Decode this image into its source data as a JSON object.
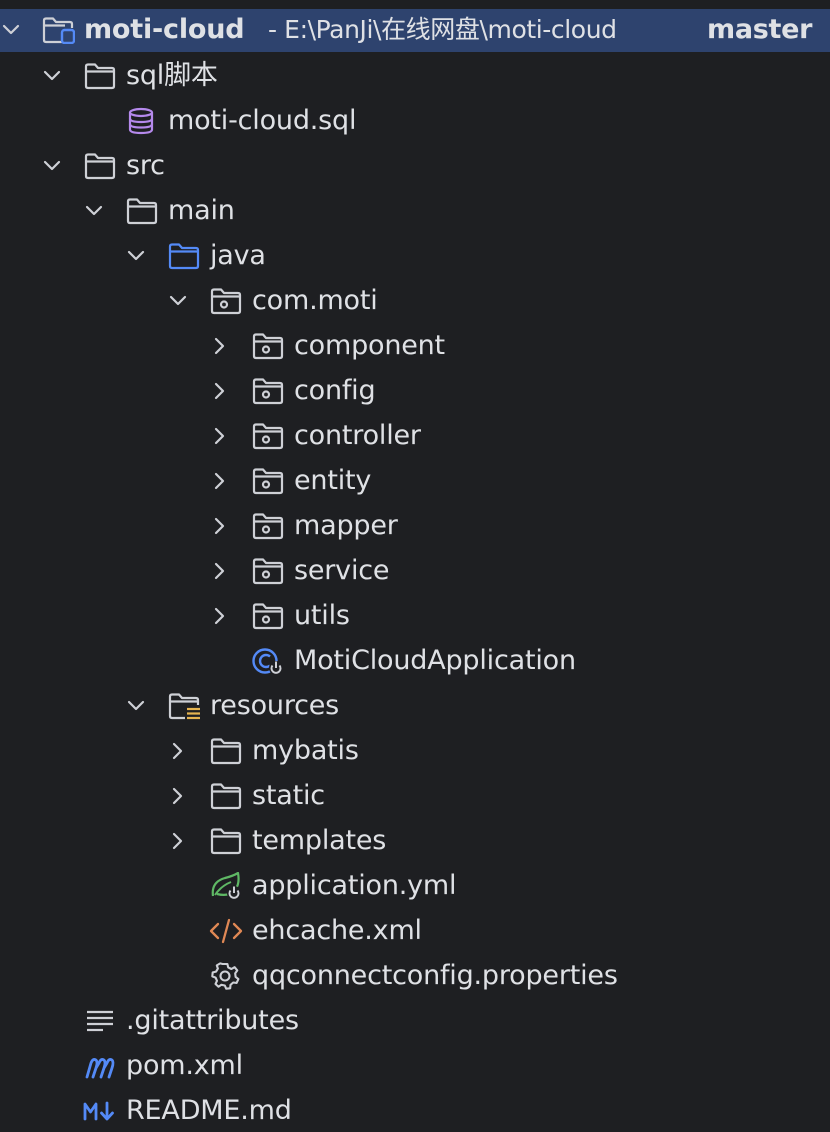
{
  "project": {
    "name": "moti-cloud",
    "path": "- E:\\PanJi\\在线网盘\\moti-cloud",
    "branch": "master"
  },
  "items": {
    "sql_dir": {
      "label": "sql脚本",
      "icon": "folder-icon"
    },
    "sql_file": {
      "label": "moti-cloud.sql",
      "icon": "database-icon"
    },
    "src": {
      "label": "src",
      "icon": "folder-icon"
    },
    "main": {
      "label": "main",
      "icon": "folder-icon"
    },
    "java": {
      "label": "java",
      "icon": "source-folder-icon"
    },
    "com_moti": {
      "label": "com.moti",
      "icon": "package-icon"
    },
    "component": {
      "label": "component",
      "icon": "package-icon"
    },
    "config": {
      "label": "config",
      "icon": "package-icon"
    },
    "controller": {
      "label": "controller",
      "icon": "package-icon"
    },
    "entity": {
      "label": "entity",
      "icon": "package-icon"
    },
    "mapper": {
      "label": "mapper",
      "icon": "package-icon"
    },
    "service": {
      "label": "service",
      "icon": "package-icon"
    },
    "utils": {
      "label": "utils",
      "icon": "package-icon"
    },
    "app_class": {
      "label": "MotiCloudApplication",
      "icon": "spring-boot-class-icon"
    },
    "resources": {
      "label": "resources",
      "icon": "resources-folder-icon"
    },
    "mybatis": {
      "label": "mybatis",
      "icon": "folder-icon"
    },
    "static": {
      "label": "static",
      "icon": "folder-icon"
    },
    "templates": {
      "label": "templates",
      "icon": "folder-icon"
    },
    "application_yml": {
      "label": "application.yml",
      "icon": "spring-config-icon"
    },
    "ehcache": {
      "label": "ehcache.xml",
      "icon": "xml-icon"
    },
    "qqconnect": {
      "label": "qqconnectconfig.properties",
      "icon": "gear-icon"
    },
    "gitattributes": {
      "label": ".gitattributes",
      "icon": "text-file-icon"
    },
    "pom": {
      "label": "pom.xml",
      "icon": "maven-icon"
    },
    "readme": {
      "label": "README.md",
      "icon": "markdown-icon"
    }
  },
  "colors": {
    "background": "#1e1f22",
    "selection": "#2e436e",
    "text": "#dfe1e5",
    "icon_gray": "#ced0d6",
    "icon_blue": "#548af7",
    "database_purple": "#b589ec",
    "spring_green": "#5fb865",
    "xml_orange": "#e08855"
  }
}
